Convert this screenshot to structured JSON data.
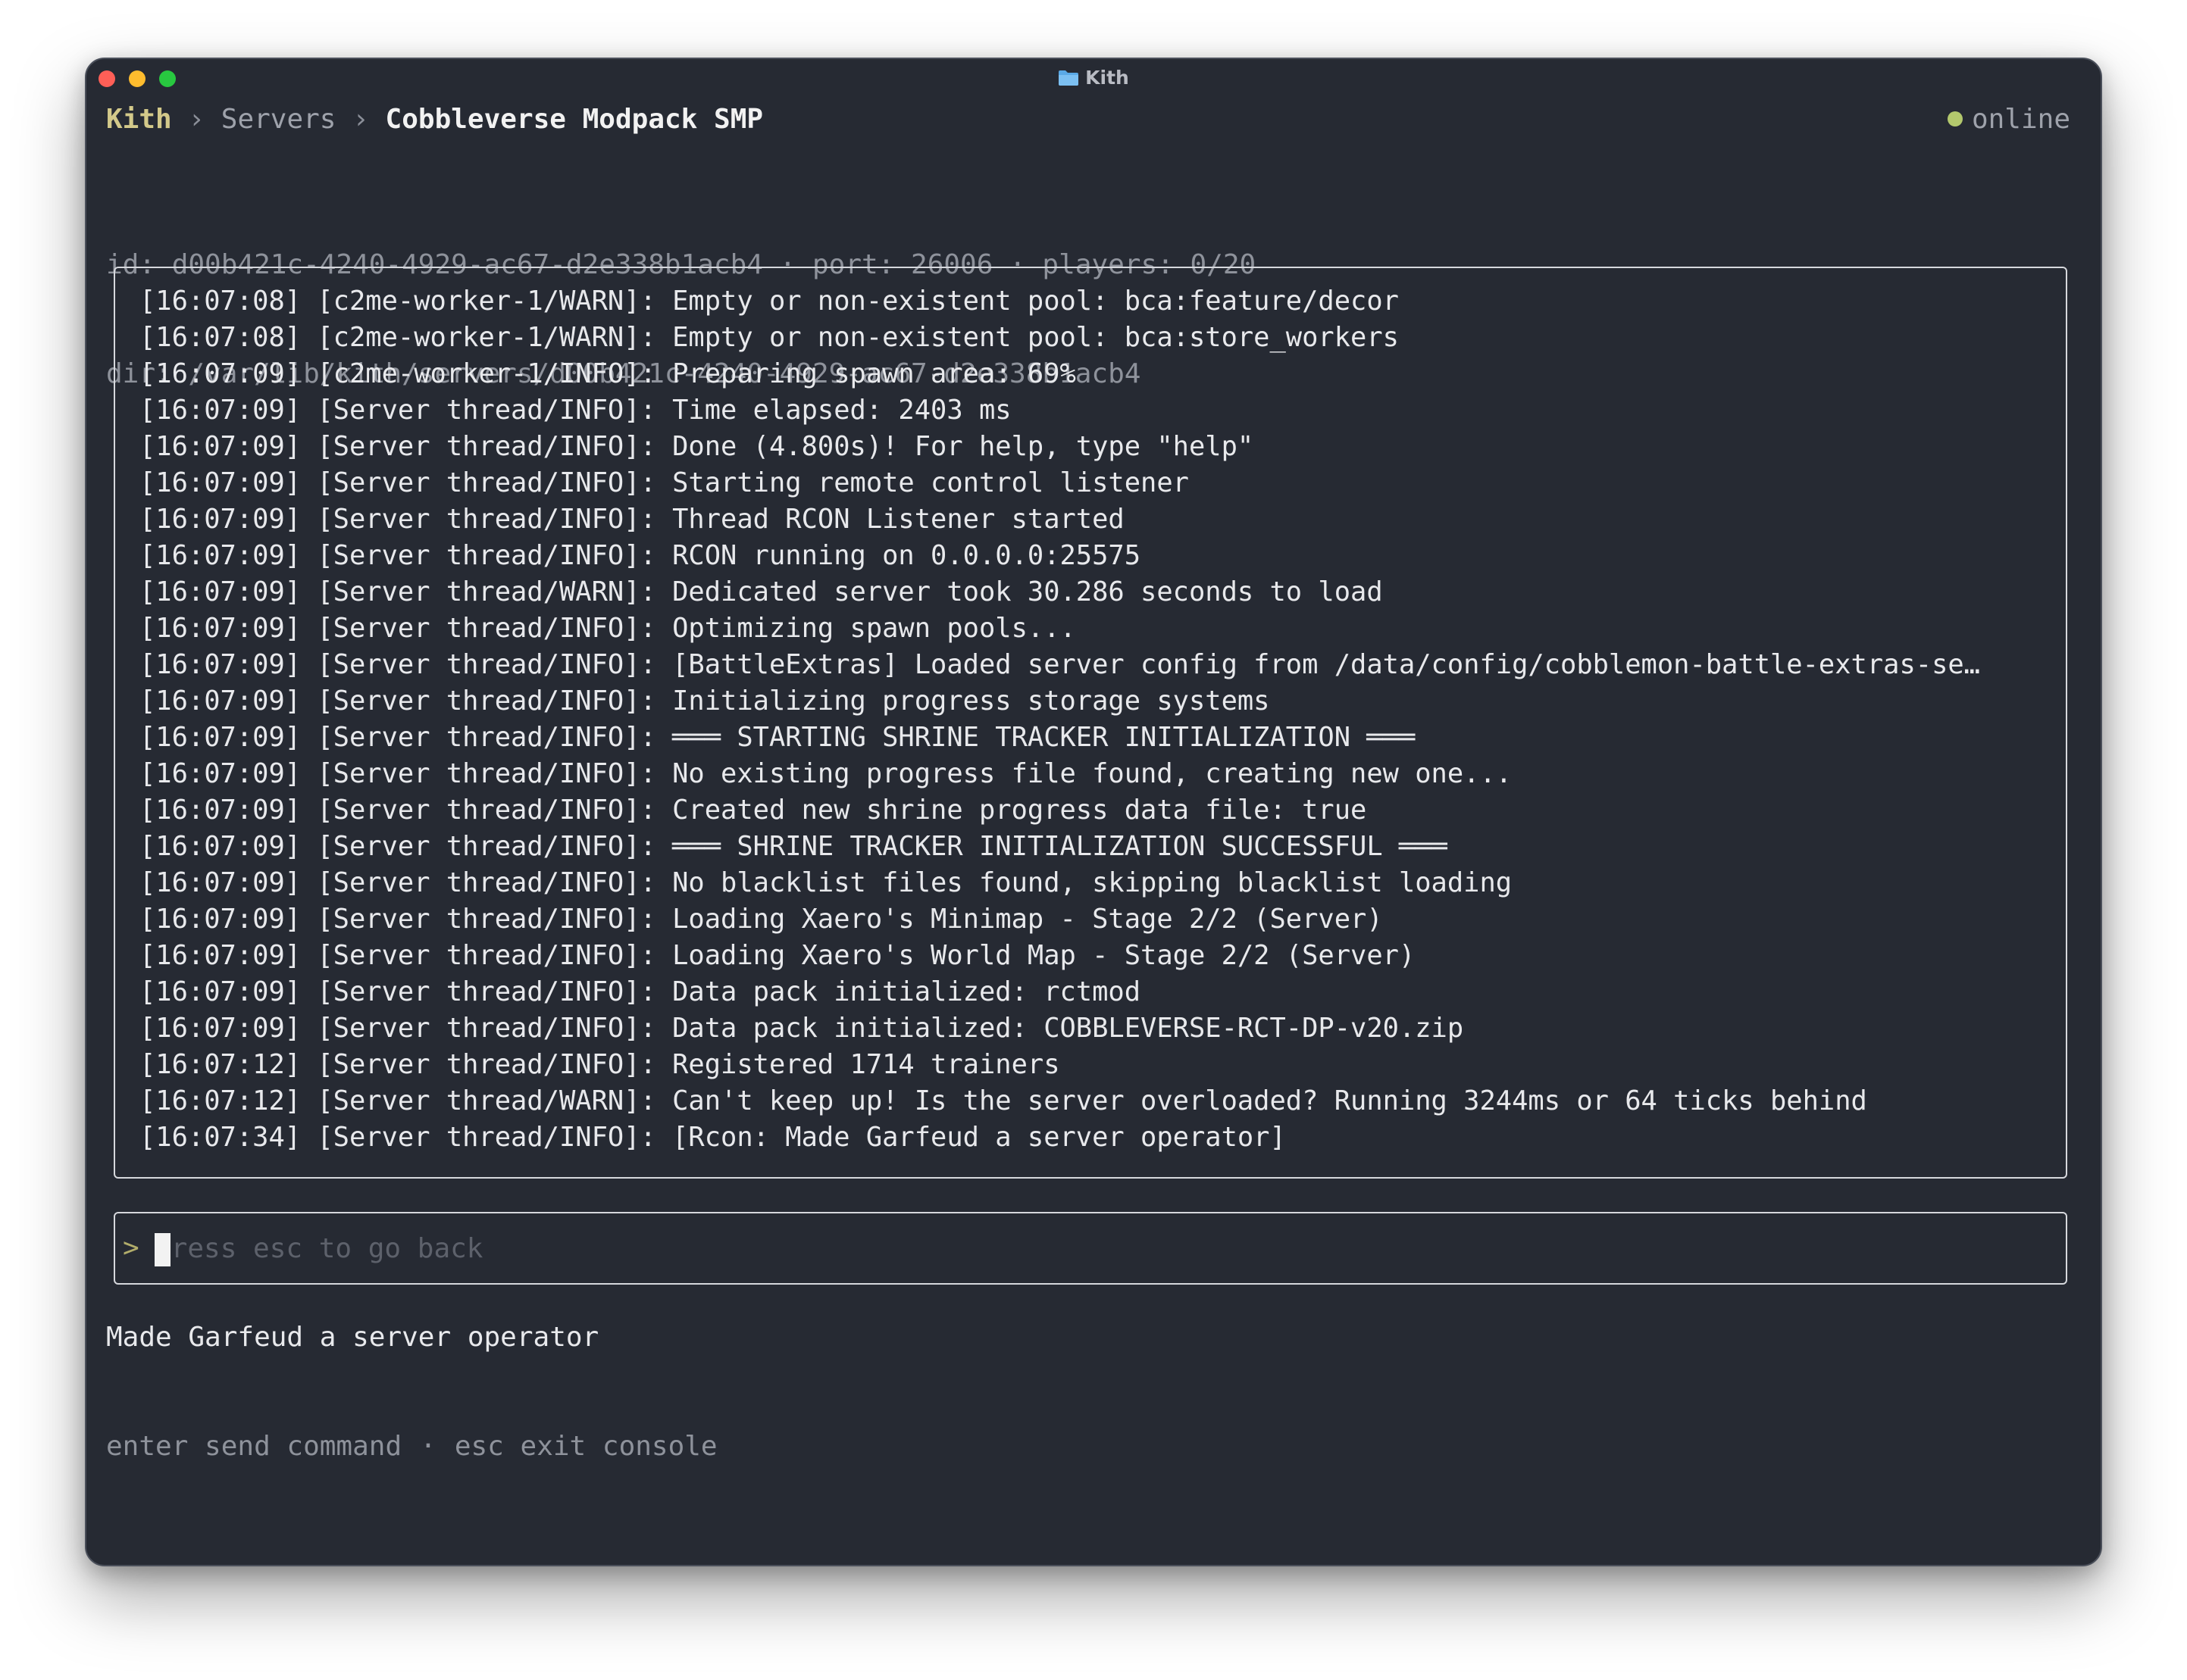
{
  "window": {
    "title": "Kith",
    "title_icon": "folder-icon"
  },
  "breadcrumb": {
    "root": "Kith",
    "section": "Servers",
    "current": "Cobbleverse Modpack SMP",
    "separator": "›"
  },
  "status": {
    "text": "online",
    "color": "#b3c86d"
  },
  "meta": {
    "line1": "id: d00b421c-4240-4929-ac67-d2e338b1acb4 · port: 26006 · players: 0/20",
    "line2": "dir: /var/lib/kith/servers/d00b421c-4240-4929-ac67-d2e338b1acb4"
  },
  "log": [
    "[16:07:08] [c2me-worker-1/WARN]: Empty or non-existent pool: bca:feature/decor",
    "[16:07:08] [c2me-worker-1/WARN]: Empty or non-existent pool: bca:store_workers",
    "[16:07:09] [c2me-worker-1/INFO]: Preparing spawn area: 69%",
    "[16:07:09] [Server thread/INFO]: Time elapsed: 2403 ms",
    "[16:07:09] [Server thread/INFO]: Done (4.800s)! For help, type \"help\"",
    "[16:07:09] [Server thread/INFO]: Starting remote control listener",
    "[16:07:09] [Server thread/INFO]: Thread RCON Listener started",
    "[16:07:09] [Server thread/INFO]: RCON running on 0.0.0.0:25575",
    "[16:07:09] [Server thread/WARN]: Dedicated server took 30.286 seconds to load",
    "[16:07:09] [Server thread/INFO]: Optimizing spawn pools...",
    "[16:07:09] [Server thread/INFO]: [BattleExtras] Loaded server config from /data/config/cobblemon-battle-extras-se…",
    "[16:07:09] [Server thread/INFO]: Initializing progress storage systems",
    "[16:07:09] [Server thread/INFO]: ═══ STARTING SHRINE TRACKER INITIALIZATION ═══",
    "[16:07:09] [Server thread/INFO]: No existing progress file found, creating new one...",
    "[16:07:09] [Server thread/INFO]: Created new shrine progress data file: true",
    "[16:07:09] [Server thread/INFO]: ═══ SHRINE TRACKER INITIALIZATION SUCCESSFUL ═══",
    "[16:07:09] [Server thread/INFO]: No blacklist files found, skipping blacklist loading",
    "[16:07:09] [Server thread/INFO]: Loading Xaero's Minimap - Stage 2/2 (Server)",
    "[16:07:09] [Server thread/INFO]: Loading Xaero's World Map - Stage 2/2 (Server)",
    "[16:07:09] [Server thread/INFO]: Data pack initialized: rctmod",
    "[16:07:09] [Server thread/INFO]: Data pack initialized: COBBLEVERSE-RCT-DP-v20.zip",
    "[16:07:12] [Server thread/INFO]: Registered 1714 trainers",
    "[16:07:12] [Server thread/WARN]: Can't keep up! Is the server overloaded? Running 3244ms or 64 ticks behind",
    "[16:07:34] [Server thread/INFO]: [Rcon: Made Garfeud a server operator]"
  ],
  "input": {
    "prompt": ">",
    "value": "",
    "placeholder": "Press esc to go back"
  },
  "response": "Made Garfeud a server operator",
  "hints": {
    "enter": "enter send command",
    "separator": "·",
    "esc": "esc exit console"
  }
}
